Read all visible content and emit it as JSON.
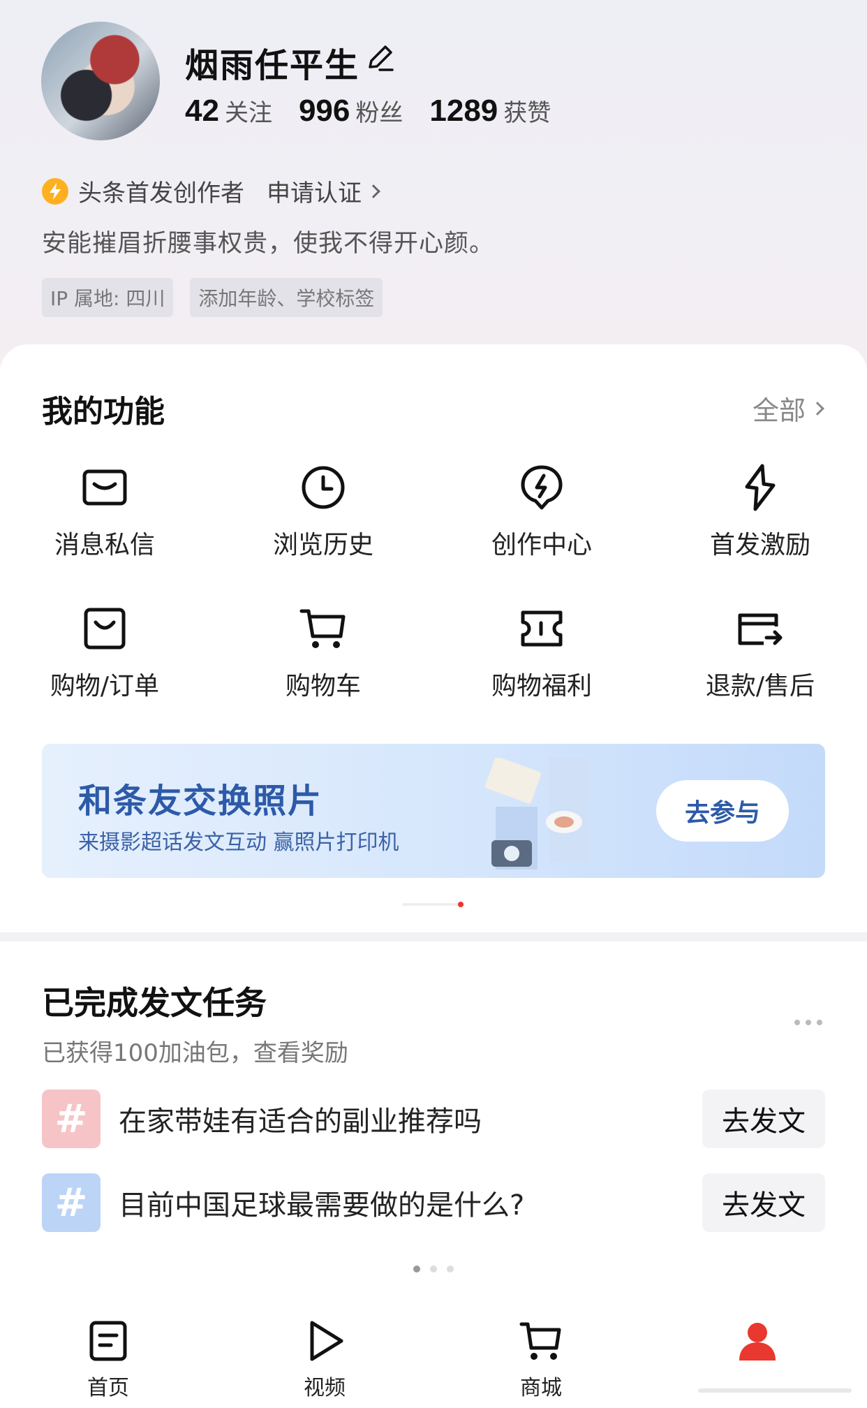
{
  "profile": {
    "username": "烟雨任平生",
    "stats": [
      {
        "num": "42",
        "label": "关注"
      },
      {
        "num": "996",
        "label": "粉丝"
      },
      {
        "num": "1289",
        "label": "获赞"
      }
    ],
    "creator_label": "头条首发创作者",
    "apply_label": "申请认证",
    "bio": "安能摧眉折腰事权贵，使我不得开心颜。",
    "tags": [
      "IP 属地: 四川",
      "添加年龄、学校标签"
    ]
  },
  "functions": {
    "title": "我的功能",
    "all_label": "全部",
    "items": [
      {
        "label": "消息私信",
        "icon": "message-icon"
      },
      {
        "label": "浏览历史",
        "icon": "clock-icon"
      },
      {
        "label": "创作中心",
        "icon": "lightning-icon"
      },
      {
        "label": "首发激励",
        "icon": "diamond-bolt-icon"
      },
      {
        "label": "购物/订单",
        "icon": "bag-icon"
      },
      {
        "label": "购物车",
        "icon": "cart-icon"
      },
      {
        "label": "购物福利",
        "icon": "ticket-icon"
      },
      {
        "label": "退款/售后",
        "icon": "refund-card-icon"
      }
    ],
    "banner": {
      "title": "和条友交换照片",
      "subtitle": "来摄影超话发文互动 赢照片打印机",
      "button": "去参与"
    }
  },
  "tasks": {
    "title": "已完成发文任务",
    "subtitle": "已获得100加油包，查看奖励",
    "items": [
      {
        "text": "在家带娃有适合的副业推荐吗",
        "button": "去发文",
        "color": "#f6c4c7"
      },
      {
        "text": "目前中国足球最需要做的是什么?",
        "button": "去发文",
        "color": "#bcd4f6"
      }
    ]
  },
  "nav": {
    "items": [
      {
        "label": "首页",
        "icon": "home-doc-icon"
      },
      {
        "label": "视频",
        "icon": "play-icon"
      },
      {
        "label": "商城",
        "icon": "cart-icon"
      },
      {
        "label": "",
        "icon": "profile-icon"
      }
    ]
  },
  "colors": {
    "accent": "#2d5aa8",
    "badge": "#ffb020",
    "active": "#e8382f"
  }
}
